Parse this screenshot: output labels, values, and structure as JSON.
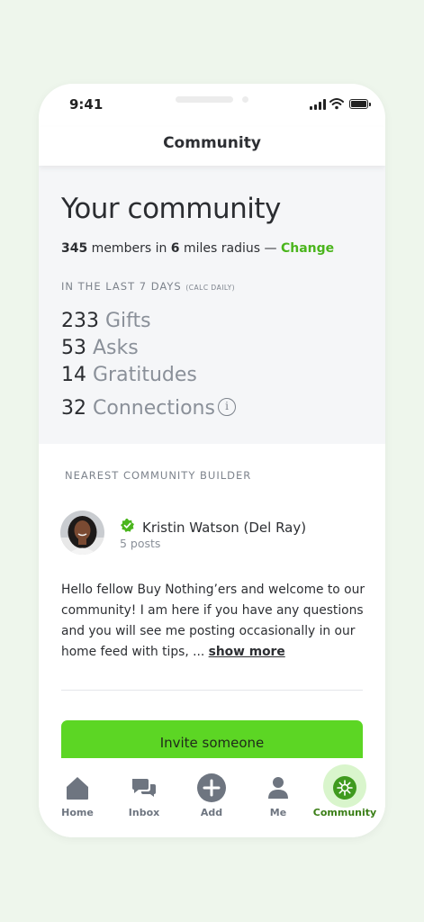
{
  "status_bar": {
    "time": "9:41"
  },
  "header": {
    "title": "Community"
  },
  "summary": {
    "heading": "Your community",
    "members_count": "345",
    "members_text": " members in ",
    "radius_value": "6",
    "radius_text": " miles radius — ",
    "change_link": "Change",
    "period_label": "IN THE LAST 7 DAYS",
    "period_note": "(CALC DAILY)",
    "stats": [
      {
        "value": "233",
        "label": "Gifts"
      },
      {
        "value": "53",
        "label": "Asks"
      },
      {
        "value": "14",
        "label": "Gratitudes"
      },
      {
        "value": "32",
        "label": "Connections"
      }
    ],
    "info_icon": "info-icon"
  },
  "builder": {
    "section_label": "NEAREST COMMUNITY BUILDER",
    "name": "Kristin Watson (Del Ray)",
    "posts": "5 posts",
    "bio": "Hello fellow Buy Nothing’ers and welcome to our community! I am here if you have any questions and you will see me posting occasionally in our home feed with tips, ... ",
    "show_more": "show more"
  },
  "invite_button": {
    "label": "Invite someone"
  },
  "tabs": [
    {
      "label": "Home",
      "icon": "home-icon"
    },
    {
      "label": "Inbox",
      "icon": "chat-icon"
    },
    {
      "label": "Add",
      "icon": "plus-icon"
    },
    {
      "label": "Me",
      "icon": "person-icon"
    },
    {
      "label": "Community",
      "icon": "community-icon",
      "active": true
    }
  ],
  "colors": {
    "accent_green": "#5cd624",
    "link_green": "#4ab51c",
    "active_tab_green": "#3a7e16",
    "background": "#eef6ec"
  }
}
